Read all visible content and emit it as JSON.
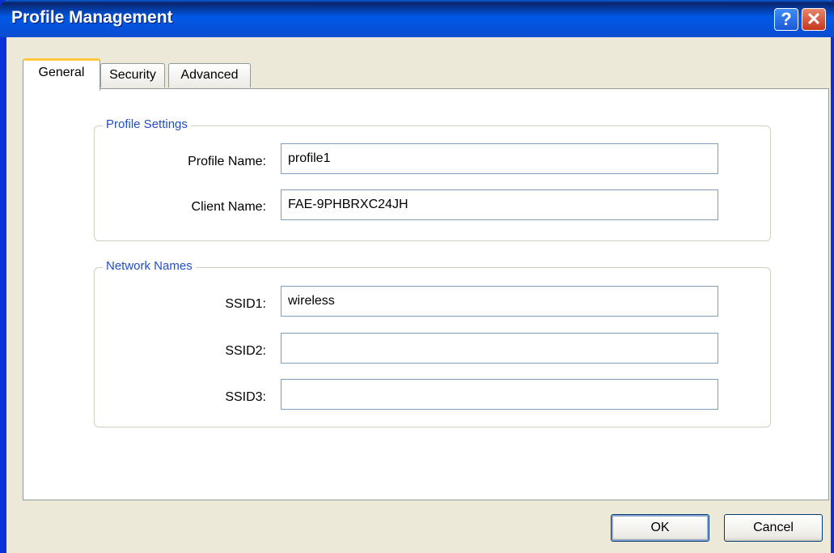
{
  "window": {
    "title": "Profile Management",
    "help_glyph": "?",
    "close_glyph": "✕"
  },
  "tabs": [
    {
      "label": "General",
      "active": true
    },
    {
      "label": "Security",
      "active": false
    },
    {
      "label": "Advanced",
      "active": false
    }
  ],
  "profile_settings": {
    "legend": "Profile Settings",
    "profile_name_label": "Profile Name:",
    "profile_name_value": "profile1",
    "client_name_label": "Client Name:",
    "client_name_value": "FAE-9PHBRXC24JH"
  },
  "network_names": {
    "legend": "Network Names",
    "ssid1_label": "SSID1:",
    "ssid1_value": "wireless",
    "ssid2_label": "SSID2:",
    "ssid2_value": "",
    "ssid3_label": "SSID3:",
    "ssid3_value": ""
  },
  "buttons": {
    "ok": "OK",
    "cancel": "Cancel"
  },
  "colors": {
    "titlebar": "#0058e6",
    "group_label": "#1f4ecb",
    "active_tab_accent": "#ffc73c",
    "window_bg": "#ece9d8"
  }
}
